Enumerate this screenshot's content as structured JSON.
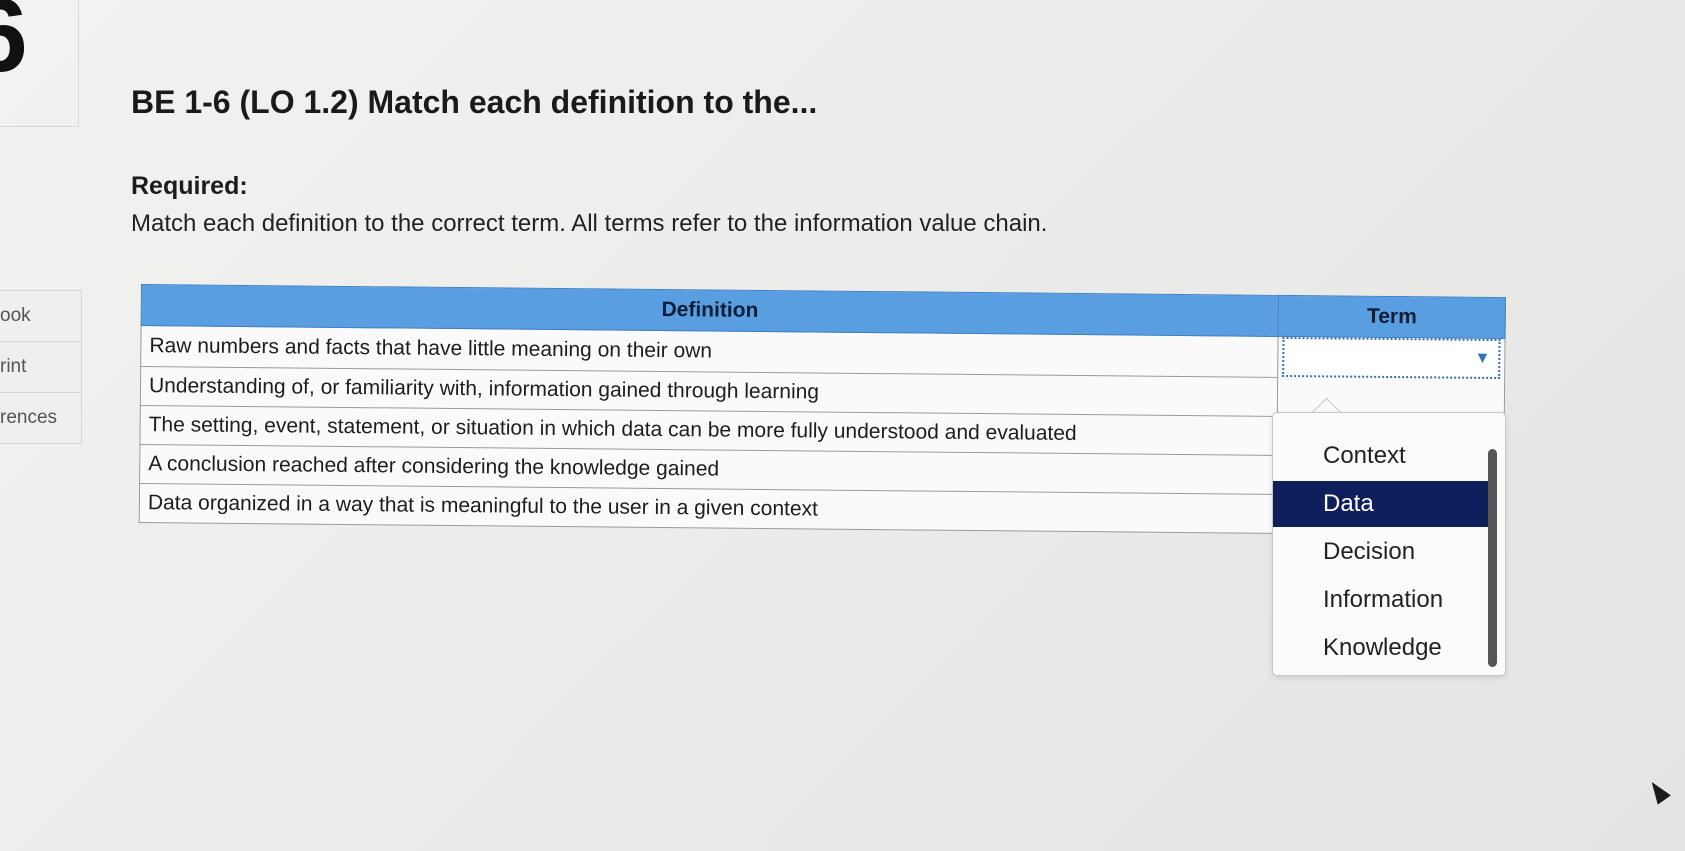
{
  "question": {
    "number": "6",
    "title": "BE 1-6 (LO 1.2) Match each definition to the...",
    "required_heading": "Required:",
    "required_text": "Match each definition to the correct term. All terms refer to the information value chain."
  },
  "side_nav": {
    "items": [
      {
        "label": "ook"
      },
      {
        "label": "rint"
      },
      {
        "label": "rences"
      }
    ]
  },
  "table": {
    "headers": {
      "definition": "Definition",
      "term": "Term"
    },
    "rows": [
      {
        "definition": "Raw numbers and facts that have little meaning on their own"
      },
      {
        "definition": "Understanding of, or familiarity with, information gained through learning"
      },
      {
        "definition": "The setting, event, statement, or situation in which data can be more fully understood and evaluated"
      },
      {
        "definition": "A conclusion reached after considering the knowledge gained"
      },
      {
        "definition": "Data organized in a way that is meaningful to the user in a given context"
      }
    ]
  },
  "dropdown": {
    "options": [
      "Context",
      "Data",
      "Decision",
      "Information",
      "Knowledge"
    ],
    "highlighted": "Data"
  },
  "colors": {
    "table_header": "#5a9ee2",
    "selected_option": "#0f1f5c"
  },
  "icons": {
    "dropdown_caret": "caret-down-icon",
    "mouse_pointer": "cursor-icon"
  }
}
